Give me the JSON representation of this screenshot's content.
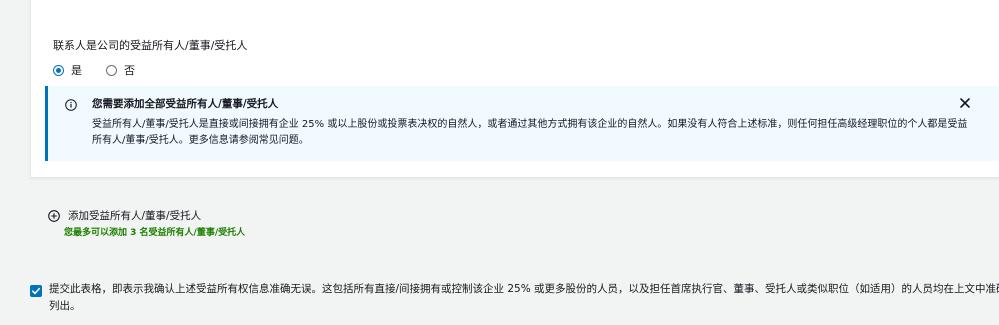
{
  "ownership_question": {
    "label": "联系人是公司的受益所有人/董事/受托人",
    "options": [
      {
        "label": "是",
        "selected": true
      },
      {
        "label": "否",
        "selected": false
      }
    ]
  },
  "info_alert": {
    "icon": "info-icon",
    "title": "您需要添加全部受益所有人/董事/受托人",
    "body": "受益所有人/董事/受托人是直接或间接拥有企业 25% 或以上股份或投票表决权的自然人，或者通过其他方式拥有该企业的自然人。如果没有人符合上述标准，则任何担任高级经理职位的个人都是受益所有人/董事/受托人。更多信息请参阅常见问题。",
    "close_icon": "close-icon"
  },
  "add_owner": {
    "icon": "add-circle-icon",
    "label": "添加受益所有人/董事/受托人",
    "hint": "您最多可以添加 3 名受益所有人/董事/受托人"
  },
  "confirmation": {
    "checked": true,
    "text": "提交此表格，即表示我确认上述受益所有权信息准确无误。这包括所有直接/间接拥有或控制该企业 25% 或更多股份的人员，以及担任首席执行官、董事、受托人或类似职位（如适用）的人员均在上文中准确列出。"
  },
  "colors": {
    "accent": "#0073bb",
    "alert_bg": "#f1faff",
    "hint_green": "#1d8102",
    "page_bg": "#f2f3f3"
  }
}
